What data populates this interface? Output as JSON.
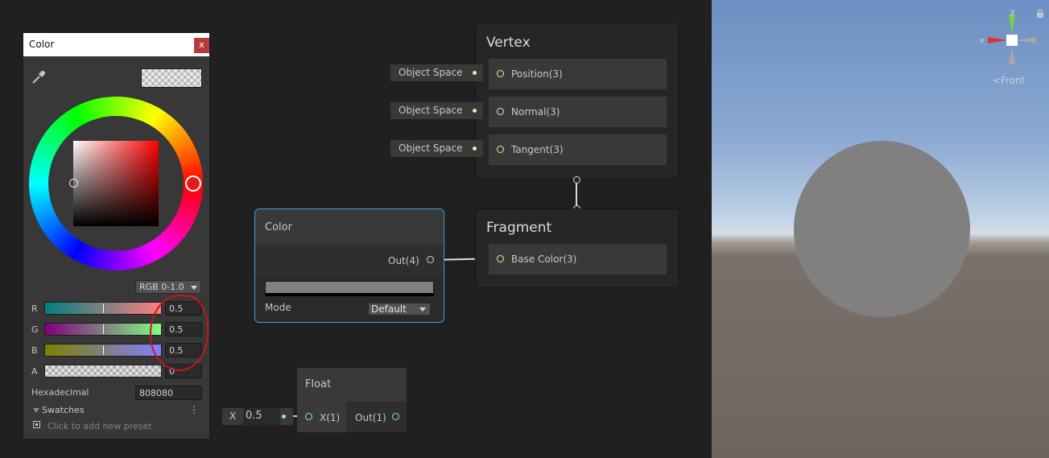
{
  "color_picker": {
    "title": "Color",
    "close_label": "x",
    "mode": "RGB 0-1.0",
    "channels": [
      {
        "label": "R",
        "value": "0.5"
      },
      {
        "label": "G",
        "value": "0.5"
      },
      {
        "label": "B",
        "value": "0.5"
      },
      {
        "label": "A",
        "value": "0"
      }
    ],
    "hex_label": "Hexadecimal",
    "hex_value": "808080",
    "swatches_label": "Swatches",
    "swatches_more": "⋮",
    "swatches_hint": "Click to add new preset"
  },
  "vertex_node": {
    "title": "Vertex",
    "ports": [
      {
        "label": "Position(3)",
        "input": "Object Space"
      },
      {
        "label": "Normal(3)",
        "input": "Object Space"
      },
      {
        "label": "Tangent(3)",
        "input": "Object Space"
      }
    ]
  },
  "fragment_node": {
    "title": "Fragment",
    "ports": [
      {
        "label": "Base Color(3)"
      }
    ]
  },
  "color_node": {
    "title": "Color",
    "output": "Out(4)",
    "swatch_color": "#808080",
    "mode_label": "Mode",
    "mode_value": "Default"
  },
  "float_node": {
    "title": "Float",
    "input": "X(1)",
    "output": "Out(1)",
    "field_label": "X",
    "field_value": "0.5"
  },
  "scene_view": {
    "gizmo_labels": {
      "x": "x",
      "y": "y"
    },
    "view_label": "Front"
  },
  "colors": {
    "selection": "#44a0d8",
    "vector_port": "#eaeda0",
    "float_port": "#84e4e7",
    "annotation": "#c8161c"
  }
}
